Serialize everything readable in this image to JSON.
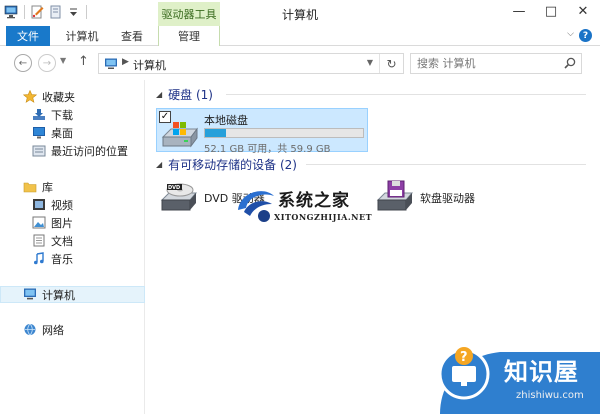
{
  "window": {
    "title": "计算机",
    "context_tab_group": "驱动器工具",
    "controls": {
      "minimize": "—",
      "maximize": "□",
      "close": "✕"
    }
  },
  "ribbon": {
    "tabs": [
      {
        "label": "文件"
      },
      {
        "label": "计算机"
      },
      {
        "label": "查看"
      },
      {
        "label": "管理"
      }
    ],
    "help": "?"
  },
  "addressbar": {
    "breadcrumb": "计算机",
    "search_placeholder": "搜索 计算机"
  },
  "navpane": {
    "favorites_header": "收藏夹",
    "favorites": [
      {
        "label": "下载"
      },
      {
        "label": "桌面"
      },
      {
        "label": "最近访问的位置"
      }
    ],
    "libraries_header": "库",
    "libraries": [
      {
        "label": "视频"
      },
      {
        "label": "图片"
      },
      {
        "label": "文档"
      },
      {
        "label": "音乐"
      }
    ],
    "computer": "计算机",
    "network": "网络"
  },
  "content": {
    "hard_disks_group": "硬盘 (1)",
    "drive": {
      "name": "本地磁盘",
      "capacity": "52.1 GB 可用，共 59.9 GB",
      "used_fraction": 0.13
    },
    "removable_group": "有可移动存储的设备 (2)",
    "devices": [
      {
        "label": "DVD 驱动器"
      },
      {
        "label": "软盘驱动器"
      }
    ]
  },
  "watermarks": {
    "site_title": "系统之家",
    "site_url": "XITONGZHIJIA.NET",
    "brand_title": "知识屋",
    "brand_url": "zhishiwu.com"
  },
  "colors": {
    "accent": "#1979ca",
    "selection": "#cce8ff",
    "progress": "#26a0da",
    "group_heading": "#1e3287"
  }
}
